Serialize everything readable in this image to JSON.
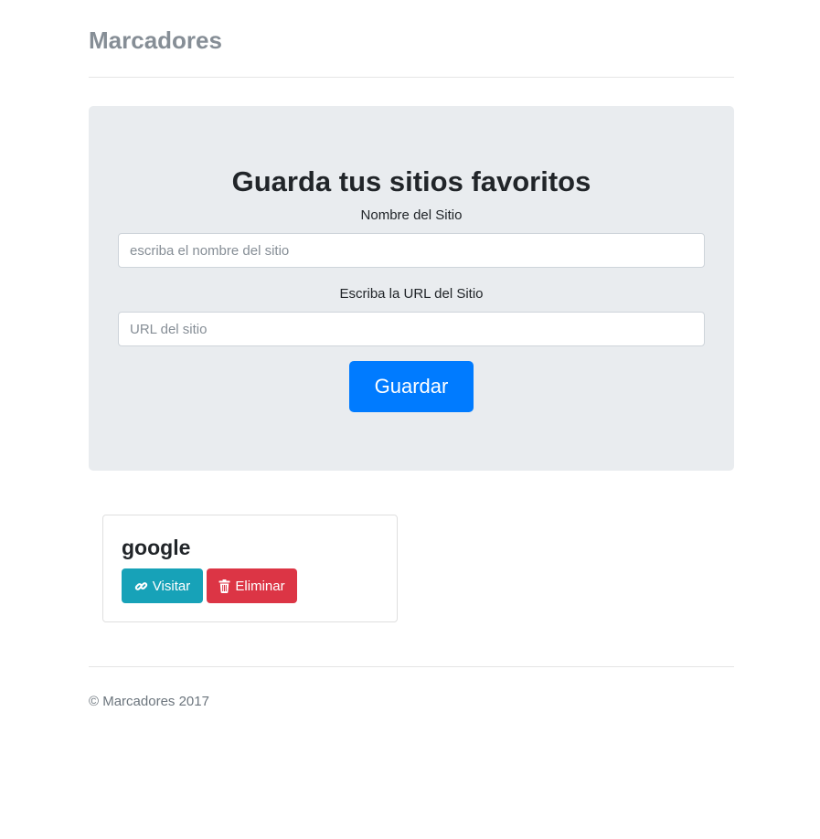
{
  "header": {
    "brand": "Marcadores"
  },
  "form": {
    "title": "Guarda tus sitios favoritos",
    "name_label": "Nombre del Sitio",
    "name_placeholder": "escriba el nombre del sitio",
    "name_value": "",
    "url_label": "Escriba la URL del Sitio",
    "url_placeholder": "URL del sitio",
    "url_value": "",
    "submit_label": "Guardar"
  },
  "bookmarks": [
    {
      "name": "google",
      "visit_label": "Visitar",
      "visit_icon": "link-icon",
      "delete_label": "Eliminar",
      "delete_icon": "trash-icon"
    }
  ],
  "footer": {
    "text": "© Marcadores 2017"
  },
  "colors": {
    "primary": "#007bff",
    "info": "#17a2b8",
    "danger": "#dc3545",
    "jumbotron": "#e9ecef",
    "brand": "#868e96"
  }
}
